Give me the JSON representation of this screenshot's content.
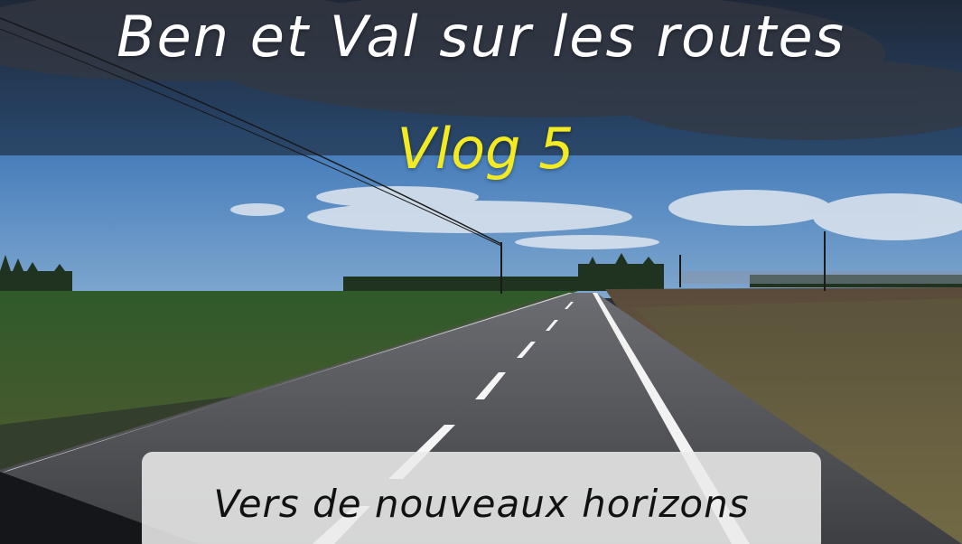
{
  "title": "Ben et Val sur les routes",
  "subtitle": "Vlog 5",
  "caption": "Vers de nouveaux horizons",
  "colors": {
    "title_text": "#ffffff",
    "subtitle_text": "#f3ea22",
    "caption_text": "#111111",
    "caption_box": "#ebebeb",
    "sky": "#3f78b8",
    "field_left": "#3f6a32",
    "field_right": "#6a5440",
    "road": "#4a4b4f"
  }
}
